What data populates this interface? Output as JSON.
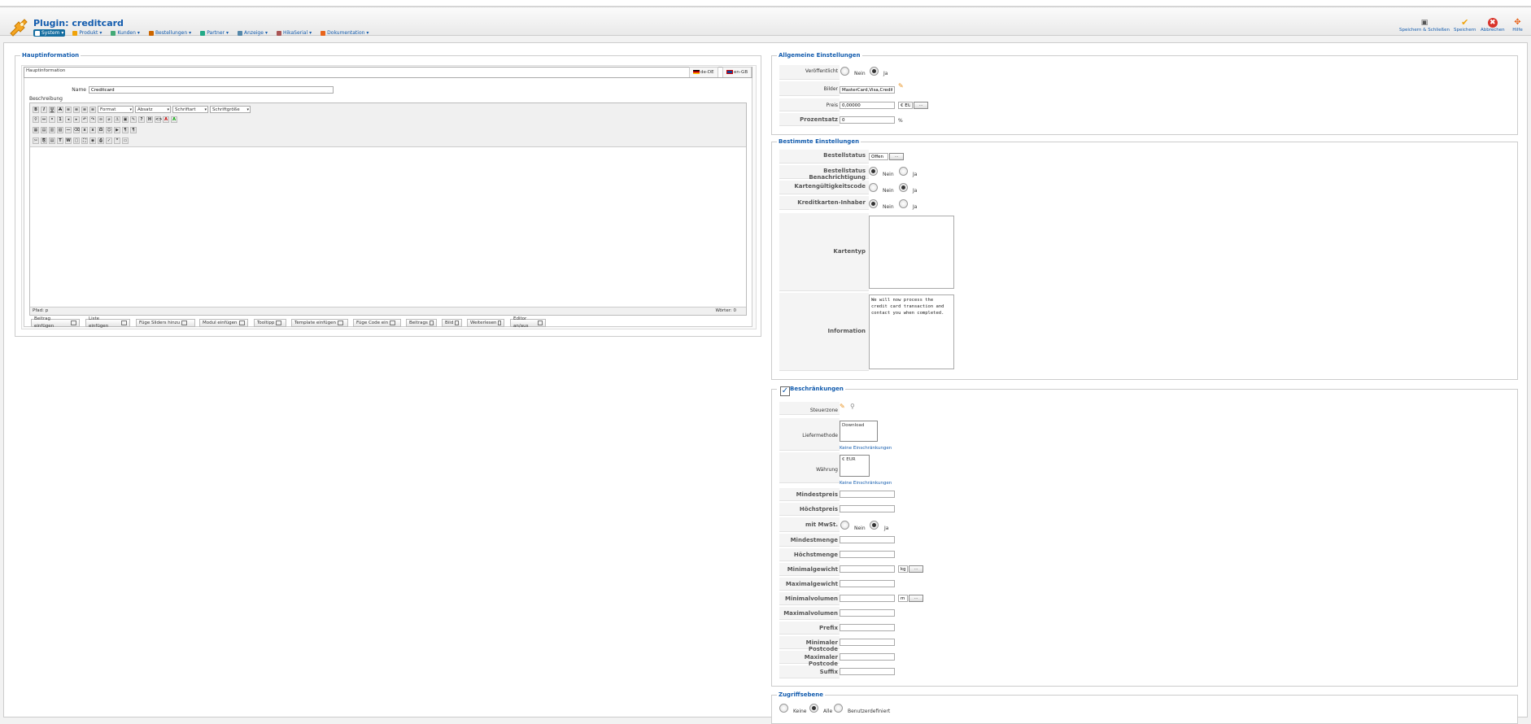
{
  "header": {
    "title": "Plugin: creditcard",
    "menu": [
      {
        "label": "System",
        "icon": "wrench-icon"
      },
      {
        "label": "Produkt",
        "icon": "box-icon"
      },
      {
        "label": "Kunden",
        "icon": "users-icon"
      },
      {
        "label": "Bestellungen",
        "icon": "cart-icon"
      },
      {
        "label": "Partner",
        "icon": "partner-icon"
      },
      {
        "label": "Anzeige",
        "icon": "display-icon"
      },
      {
        "label": "HikaSerial",
        "icon": "serial-icon"
      },
      {
        "label": "Dokumentation",
        "icon": "help-icon"
      }
    ],
    "actions": {
      "save_close": "Speichern & Schließen",
      "save": "Speichern",
      "cancel": "Abbrechen",
      "help": "Hilfe"
    }
  },
  "main": {
    "legend": "Hauptinformation",
    "tab": "Hauptinformation",
    "lang_tabs": [
      "de-DE",
      "en-GB"
    ],
    "name_label": "Name",
    "name_value": "Creditcard",
    "description_label": "Beschreibung",
    "editor": {
      "format": "Format",
      "paragraph": "Absatz",
      "font": "Schriftart",
      "fontsize": "Schriftgröße",
      "path": "Pfad: p",
      "words": "Wörter: 0"
    },
    "buttons": [
      "Beitrag einfügen",
      "Liste einfügen",
      "Füge Sliders hinzu",
      "Modul einfügen",
      "Tooltipp",
      "Template einfügen",
      "Füge Code ein",
      "Beitrags",
      "Bild",
      "Weiterlesen",
      "Editor an/aus"
    ]
  },
  "general": {
    "legend": "Allgemeine Einstellungen",
    "published_label": "Veröffentlicht",
    "no": "Nein",
    "yes": "Ja",
    "images_label": "Bilder",
    "images_value": "MasterCard,Visa,Credit_card",
    "price_label": "Preis",
    "price_value": "0,00000",
    "currency_value": "€ EUR",
    "percent_label": "Prozentsatz",
    "percent_value": "0",
    "percent_unit": "%"
  },
  "specific": {
    "legend": "Bestimmte Einstellungen",
    "status_label": "Bestellstatus",
    "status_value": "Offen",
    "notify_label": "Bestellstatus Benachrichtigung",
    "cvv_label": "Kartengültigkeitscode",
    "holder_label": "Kreditkarten-Inhaber",
    "cardtype_label": "Kartentyp",
    "information_label": "Information",
    "information_value": "We will now process the credit card transaction and contact you when completed.",
    "no": "Nein",
    "yes": "Ja"
  },
  "restrictions": {
    "legend": "Beschränkungen",
    "tax_label": "Steuerzone",
    "shipping_label": "Liefermethode",
    "shipping_value": "Download",
    "no_restriction": "Keine Einschränkungen",
    "currency_label": "Währung",
    "currency_value": "€ EUR",
    "min_price": "Mindestpreis",
    "max_price": "Höchstpreis",
    "with_vat": "mit MwSt.",
    "no": "Nein",
    "yes": "Ja",
    "min_qty": "Mindestmenge",
    "max_qty": "Höchstmenge",
    "min_weight": "Minimalgewicht",
    "weight_unit": "kg",
    "max_weight": "Maximalgewicht",
    "min_volume": "Minimalvolumen",
    "volume_unit": "m",
    "max_volume": "Maximalvolumen",
    "prefix": "Prefix",
    "min_zip": "Minimaler Postcode",
    "max_zip": "Maximaler Postcode",
    "suffix": "Suffix"
  },
  "access": {
    "legend": "Zugriffsebene",
    "none": "Keine",
    "all": "Alle",
    "custom": "Benutzerdefiniert"
  }
}
